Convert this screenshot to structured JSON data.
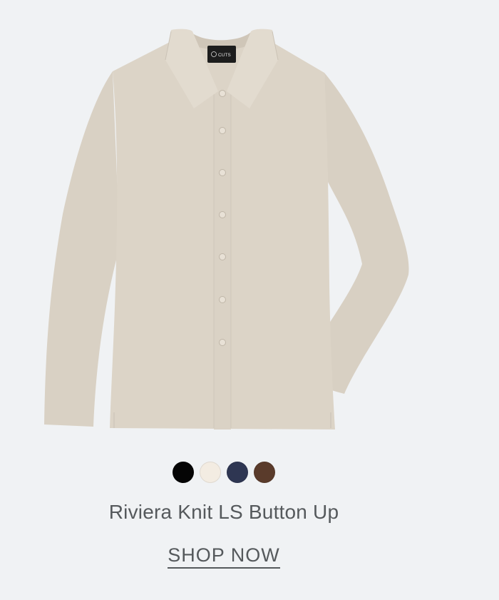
{
  "product": {
    "brand_label": "CUTS",
    "name": "Riviera Knit LS Button Up",
    "cta_label": "SHOP NOW",
    "shirt_color": "#ddd5c8",
    "swatches": [
      {
        "color": "#050505"
      },
      {
        "color": "#f3ece2"
      },
      {
        "color": "#2e3652"
      },
      {
        "color": "#5a3b2b"
      }
    ]
  }
}
